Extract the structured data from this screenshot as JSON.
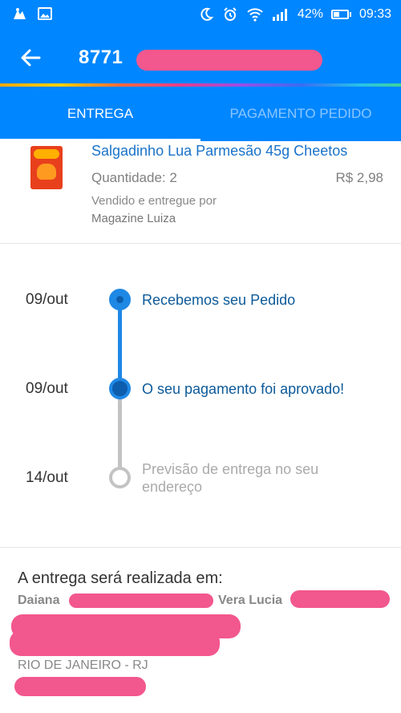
{
  "status_bar": {
    "battery": "42%",
    "battery_level": 0.42,
    "time": "09:33",
    "icons": [
      "app-notification-icon",
      "image-notification-icon",
      "moon-icon",
      "alarm-icon",
      "wifi-icon",
      "signal-icon",
      "battery-icon"
    ]
  },
  "app_bar": {
    "title": "8771",
    "back_icon": "arrow-left-icon"
  },
  "tabs": [
    {
      "label": "ENTREGA",
      "active": true
    },
    {
      "label": "PAGAMENTO PEDIDO",
      "active": false
    }
  ],
  "product": {
    "name": "Salgadinho Lua Parmesão 45g Cheetos",
    "quantity": "Quantidade: 2",
    "price": "R$ 2,98",
    "sold_by_label": "Vendido e entregue por",
    "seller": "Magazine Luiza"
  },
  "timeline": [
    {
      "date": "09/out",
      "text": "Recebemos seu Pedido",
      "status": "done"
    },
    {
      "date": "09/out",
      "text": "O seu pagamento foi aprovado!",
      "status": "current"
    },
    {
      "date": "14/out",
      "text": "Previsão de entrega no seu endereço",
      "status": "pending"
    }
  ],
  "address": {
    "title": "A entrega será realizada em:",
    "name_first": "Daiana",
    "name_second": "Vera Lucia",
    "city": "RIO DE JANEIRO - RJ"
  },
  "colors": {
    "primary": "#0086ff",
    "timeline_active": "#1e88e5",
    "timeline_pending": "#c3c3c3",
    "link_text": "#1a73c9",
    "redaction": "#f2578d"
  }
}
